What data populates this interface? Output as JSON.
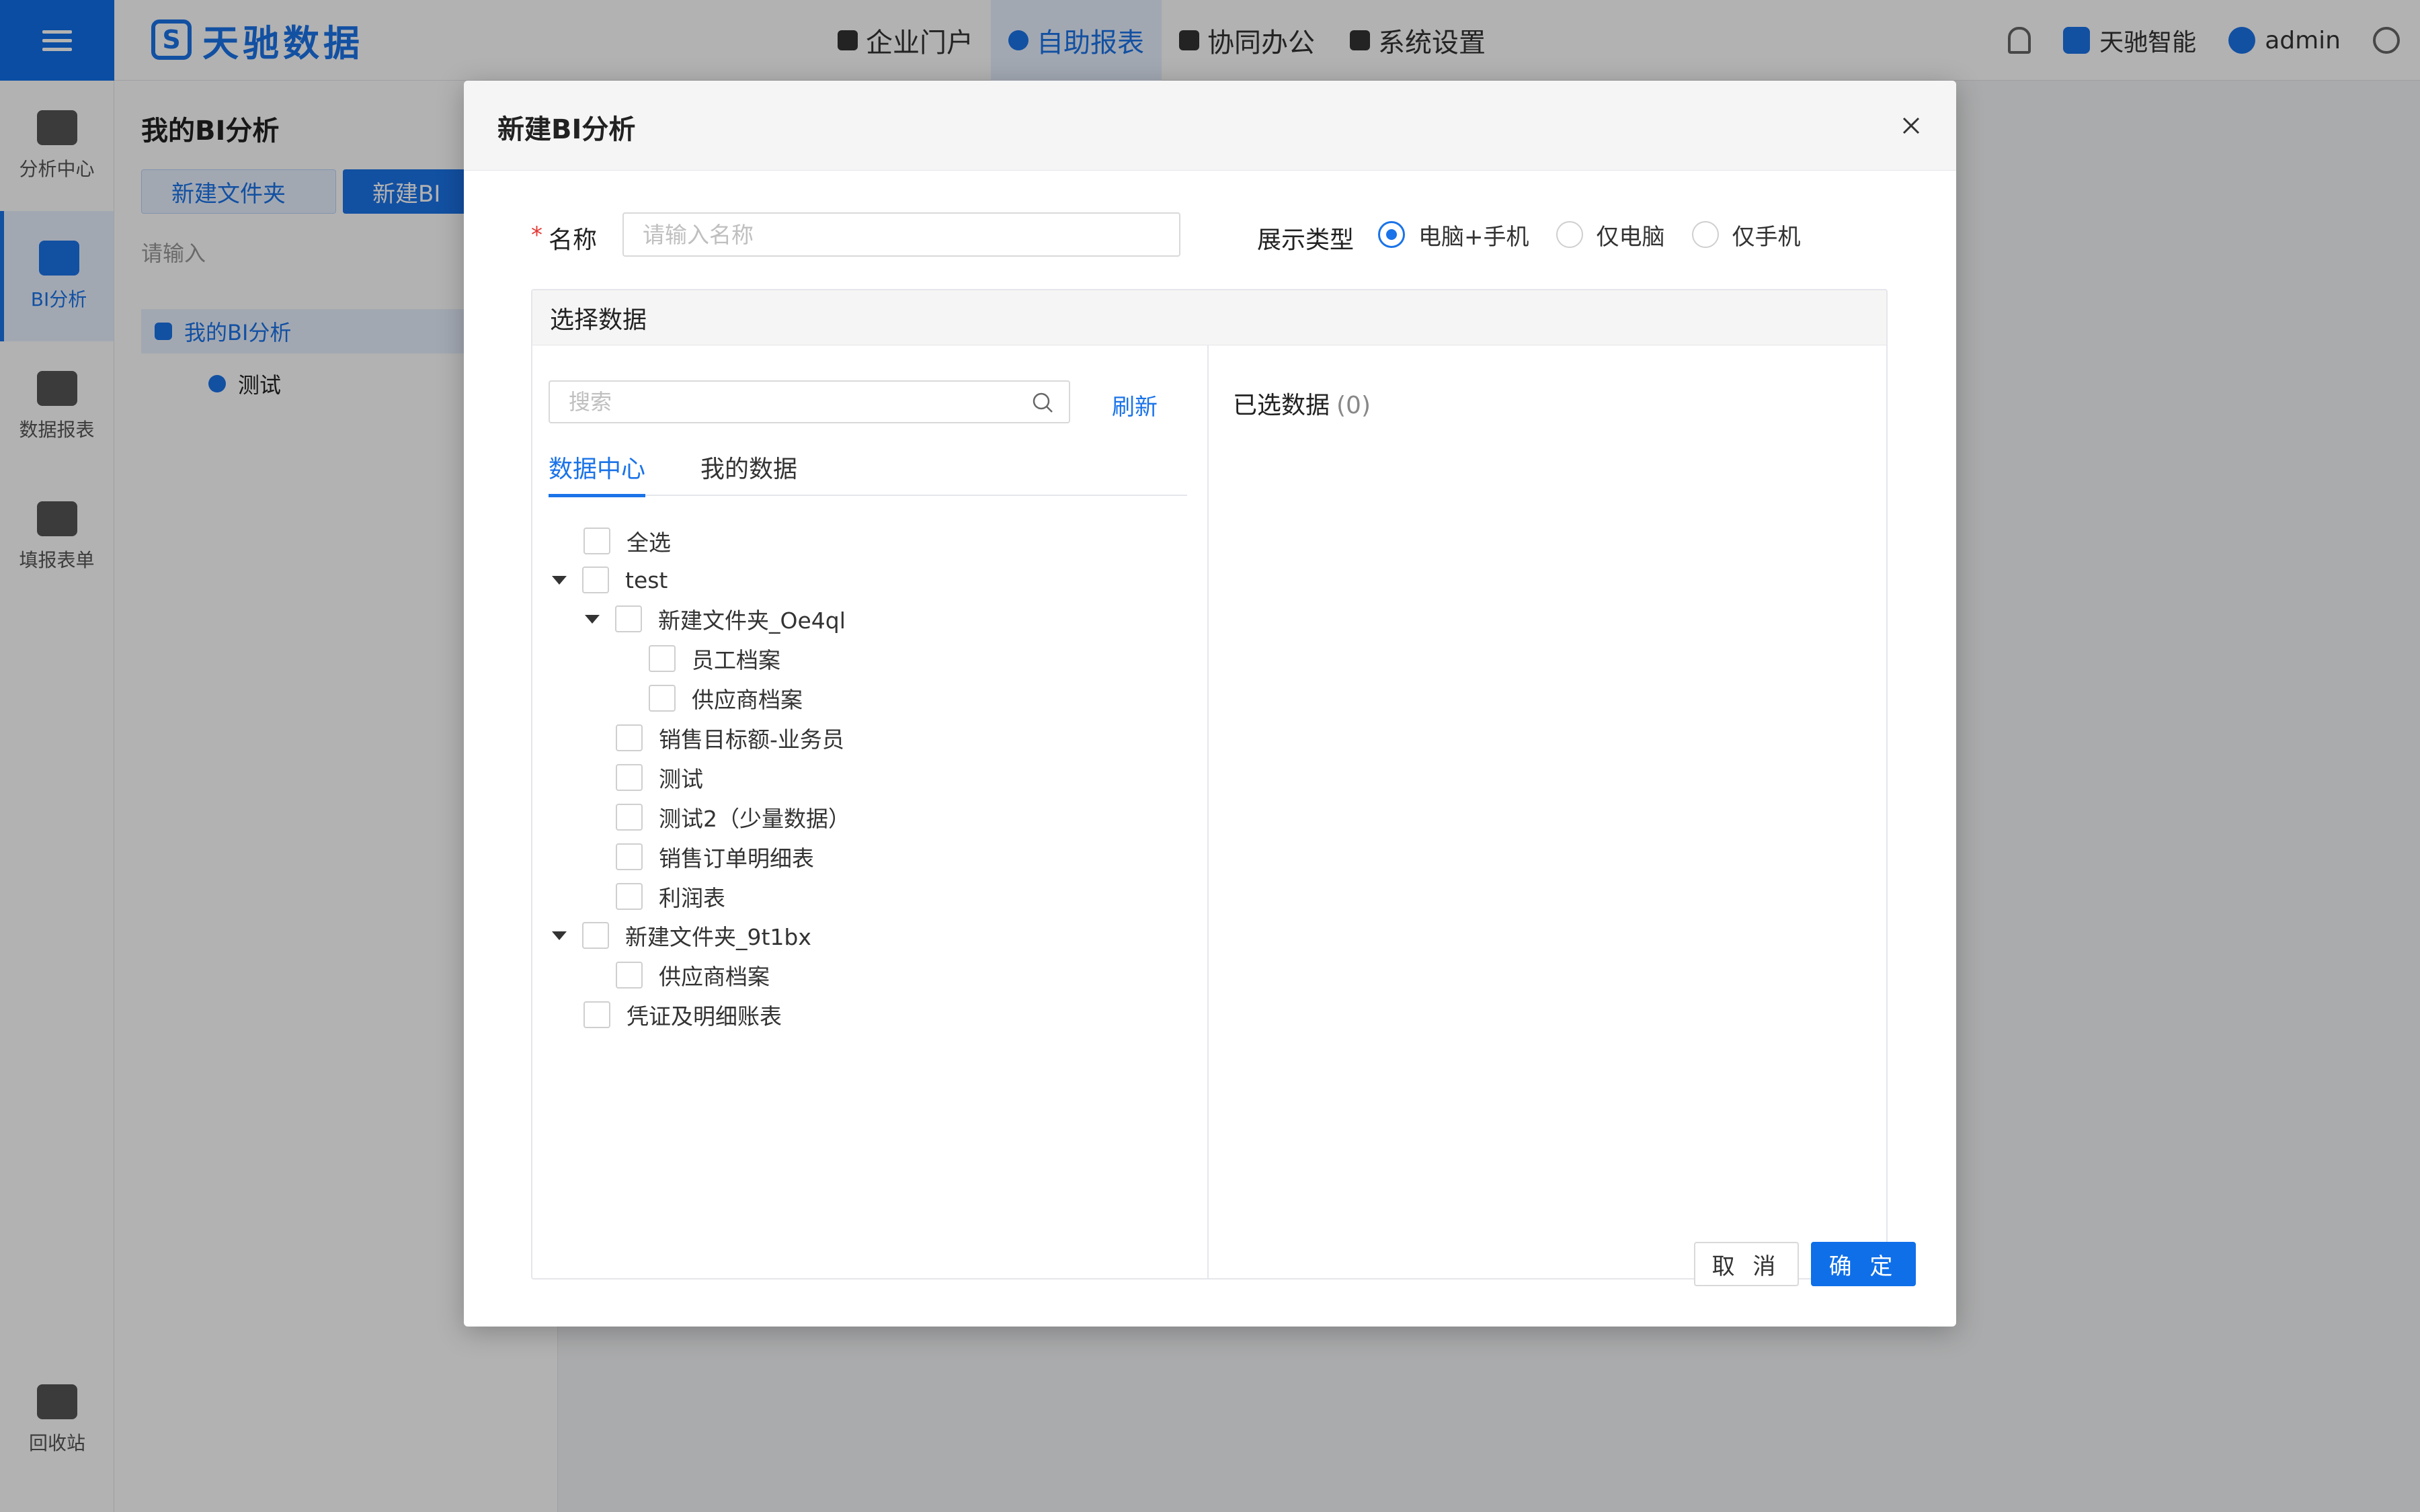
{
  "app": {
    "logo_text": "天驰数据",
    "nav": [
      {
        "label": "企业门户",
        "active": false
      },
      {
        "label": "自助报表",
        "active": true
      },
      {
        "label": "协同办公",
        "active": false
      },
      {
        "label": "系统设置",
        "active": false
      }
    ],
    "top_right": {
      "org": "天驰智能",
      "user": "admin"
    },
    "sidebar": [
      {
        "label": "分析中心",
        "active": false
      },
      {
        "label": "BI分析",
        "active": true
      },
      {
        "label": "数据报表",
        "active": false
      },
      {
        "label": "填报表单",
        "active": false
      }
    ],
    "sidebar_bottom": "回收站",
    "panel": {
      "title": "我的BI分析",
      "btn_folder": "新建文件夹",
      "btn_new": "新建BI",
      "search_placeholder": "请输入",
      "tree": [
        "我的BI分析",
        "测试"
      ]
    }
  },
  "modal": {
    "title": "新建BI分析",
    "name_label": "名称",
    "name_placeholder": "请输入名称",
    "name_value": "",
    "type_label": "展示类型",
    "type_options": [
      {
        "label": "电脑+手机",
        "checked": true
      },
      {
        "label": "仅电脑",
        "checked": false
      },
      {
        "label": "仅手机",
        "checked": false
      }
    ],
    "select_data_title": "选择数据",
    "search_placeholder": "搜索",
    "refresh": "刷新",
    "tabs": [
      {
        "label": "数据中心",
        "active": true
      },
      {
        "label": "我的数据",
        "active": false
      }
    ],
    "tree": {
      "select_all": "全选",
      "items": [
        {
          "label": "test",
          "level": 1,
          "expandable": true
        },
        {
          "label": "新建文件夹_Oe4ql",
          "level": 2,
          "expandable": true
        },
        {
          "label": "员工档案",
          "level": 3,
          "expandable": false
        },
        {
          "label": "供应商档案",
          "level": 3,
          "expandable": false
        },
        {
          "label": "销售目标额-业务员",
          "level": 2,
          "expandable": false
        },
        {
          "label": "测试",
          "level": 2,
          "expandable": false
        },
        {
          "label": "测试2（少量数据）",
          "level": 2,
          "expandable": false
        },
        {
          "label": "销售订单明细表",
          "level": 2,
          "expandable": false
        },
        {
          "label": "利润表",
          "level": 2,
          "expandable": false
        },
        {
          "label": "新建文件夹_9t1bx",
          "level": 1,
          "expandable": true
        },
        {
          "label": "供应商档案",
          "level": 2,
          "expandable": false
        },
        {
          "label": "凭证及明细账表",
          "level": 1,
          "expandable": false
        }
      ]
    },
    "selected_label": "已选数据",
    "selected_count": "(0)",
    "cancel": "取 消",
    "confirm": "确 定"
  },
  "colors": {
    "primary": "#1a73e8",
    "required": "#e53935"
  }
}
